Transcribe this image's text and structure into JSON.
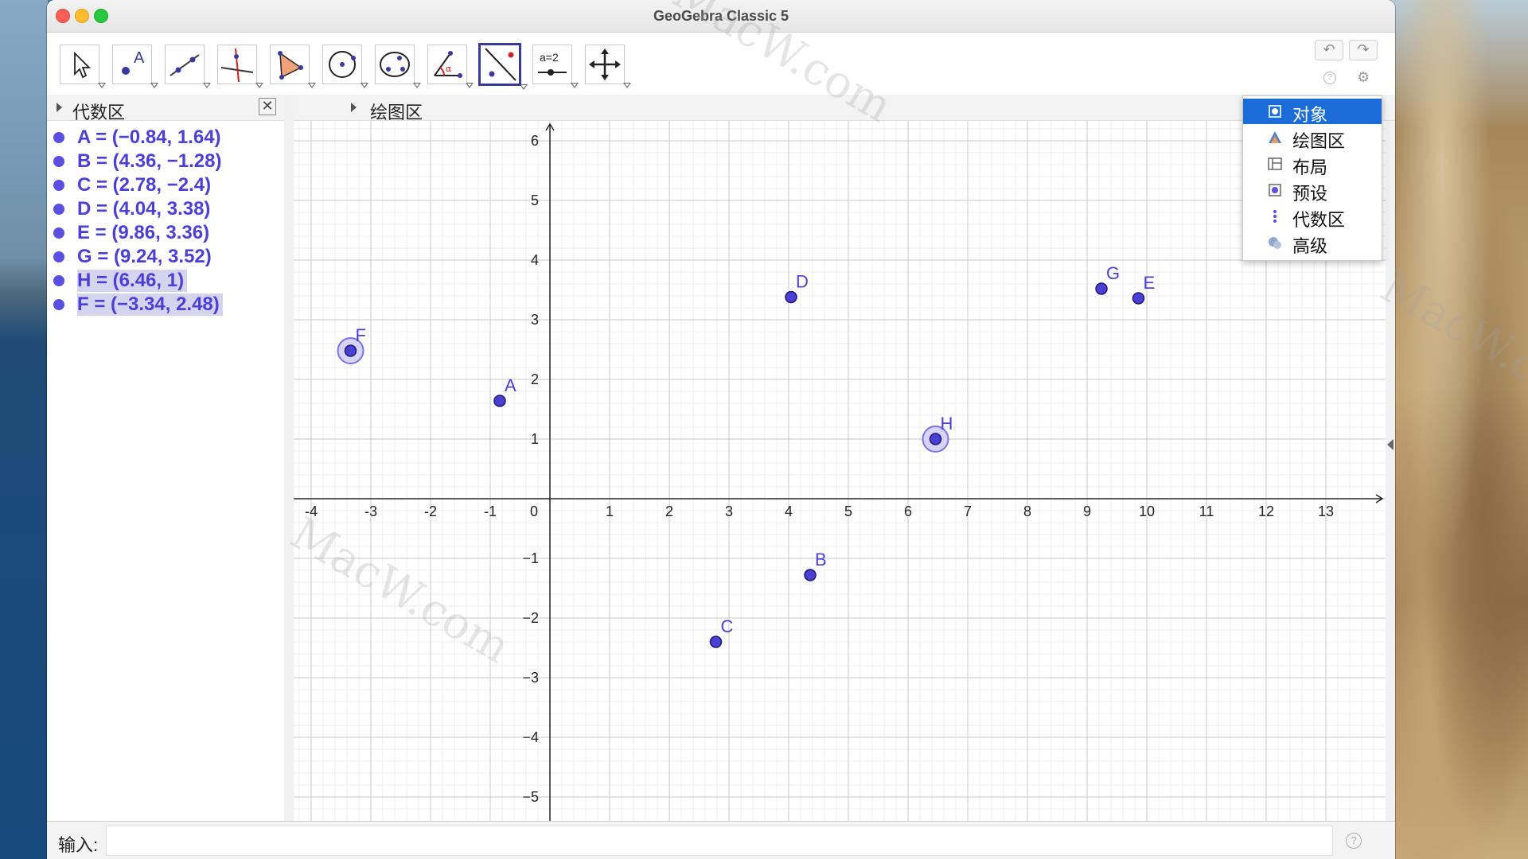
{
  "window": {
    "title": "GeoGebra Classic 5"
  },
  "toolbar": {
    "tools": [
      "move-tool",
      "point-tool",
      "line-tool",
      "perpendicular-tool",
      "polygon-tool",
      "circle-tool",
      "conic-tool",
      "angle-tool",
      "reflect-tool",
      "slider-tool",
      "move-graphics-tool"
    ],
    "active_tool": "reflect-tool",
    "slider_label": "a=2"
  },
  "algebra": {
    "title": "代数区",
    "items": [
      {
        "text": "A = (−0.84, 1.64)",
        "selected": false
      },
      {
        "text": "B = (4.36, −1.28)",
        "selected": false
      },
      {
        "text": "C = (2.78, −2.4)",
        "selected": false
      },
      {
        "text": "D = (4.04, 3.38)",
        "selected": false
      },
      {
        "text": "E = (9.86, 3.36)",
        "selected": false
      },
      {
        "text": "G = (9.24, 3.52)",
        "selected": false
      },
      {
        "text": "H = (6.46, 1)",
        "selected": true
      },
      {
        "text": "F = (−3.34, 2.48)",
        "selected": true
      }
    ]
  },
  "graphics": {
    "title": "绘图区",
    "x_ticks": [
      "-4",
      "-3",
      "-2",
      "-1",
      "0",
      "1",
      "2",
      "3",
      "4",
      "5",
      "6",
      "7",
      "8",
      "9",
      "10",
      "11",
      "12",
      "13"
    ],
    "y_ticks": [
      "6",
      "5",
      "4",
      "3",
      "2",
      "1",
      "−1",
      "−2",
      "−3",
      "−4",
      "−5"
    ],
    "points": [
      {
        "label": "A",
        "x": -0.84,
        "y": 1.64,
        "selected": false
      },
      {
        "label": "B",
        "x": 4.36,
        "y": -1.28,
        "selected": false
      },
      {
        "label": "C",
        "x": 2.78,
        "y": -2.4,
        "selected": false
      },
      {
        "label": "D",
        "x": 4.04,
        "y": 3.38,
        "selected": false
      },
      {
        "label": "E",
        "x": 9.86,
        "y": 3.36,
        "selected": false
      },
      {
        "label": "G",
        "x": 9.24,
        "y": 3.52,
        "selected": false
      },
      {
        "label": "H",
        "x": 6.46,
        "y": 1,
        "selected": true
      },
      {
        "label": "F",
        "x": -3.34,
        "y": 2.48,
        "selected": true
      }
    ],
    "point_color": "#4b3fd6"
  },
  "menu": {
    "items": [
      {
        "label": "对象",
        "icon": "object-icon",
        "active": true
      },
      {
        "label": "绘图区",
        "icon": "graphics-view-icon",
        "active": false
      },
      {
        "label": "布局",
        "icon": "layout-icon",
        "active": false
      },
      {
        "label": "预设",
        "icon": "defaults-icon",
        "active": false
      },
      {
        "label": "代数区",
        "icon": "algebra-view-icon",
        "active": false
      },
      {
        "label": "高级",
        "icon": "advanced-icon",
        "active": false
      }
    ]
  },
  "input_bar": {
    "label": "输入:",
    "value": ""
  },
  "watermarks": [
    "MacW.com",
    "MacW.com",
    "MacW.com"
  ]
}
